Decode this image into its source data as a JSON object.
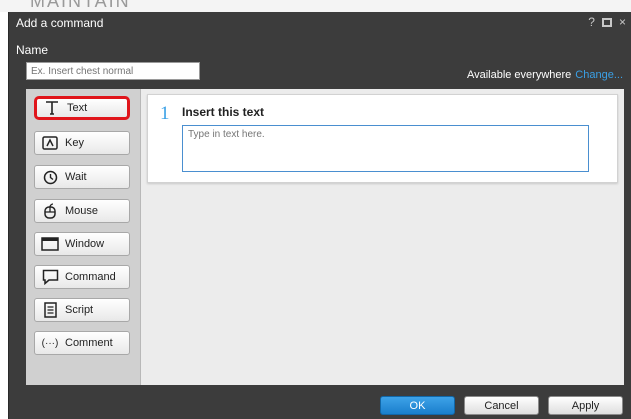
{
  "background": {
    "partial_text": "MAINTAIN"
  },
  "window": {
    "title": "Add a command",
    "help": "?",
    "close": "×"
  },
  "name": {
    "label": "Name",
    "placeholder": "Ex. Insert chest normal",
    "value": ""
  },
  "availability": {
    "label": "Available everywhere",
    "change_link": "Change..."
  },
  "commands": [
    {
      "label": "Text",
      "icon": "text-icon",
      "selected": true
    },
    {
      "label": "Key",
      "icon": "key-icon",
      "selected": false
    },
    {
      "label": "Wait",
      "icon": "clock-icon",
      "selected": false
    },
    {
      "label": "Mouse",
      "icon": "mouse-icon",
      "selected": false
    },
    {
      "label": "Window",
      "icon": "window-icon",
      "selected": false
    },
    {
      "label": "Command",
      "icon": "speech-bubble-icon",
      "selected": false
    },
    {
      "label": "Script",
      "icon": "document-icon",
      "selected": false
    },
    {
      "label": "Comment",
      "icon": "ellipsis-icon",
      "selected": false
    }
  ],
  "step": {
    "number": "1",
    "title": "Insert this text",
    "placeholder": "Type in text here."
  },
  "footer": {
    "ok": "OK",
    "cancel": "Cancel",
    "apply": "Apply"
  },
  "colors": {
    "accent": "#3aa0e6",
    "selection": "#e0151b",
    "window_bg": "#3c3c3c"
  }
}
